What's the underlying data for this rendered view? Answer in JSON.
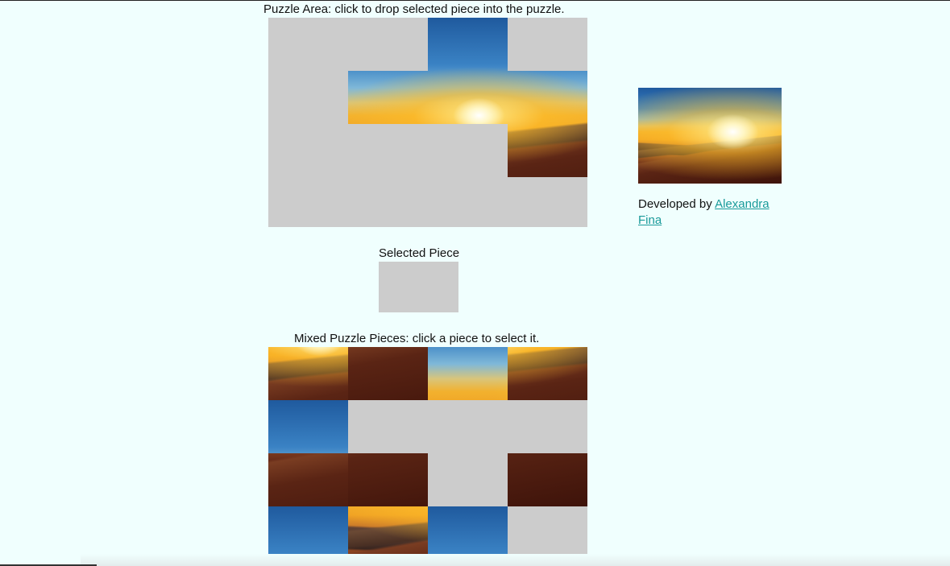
{
  "puzzle_area": {
    "label": "Puzzle Area: click to drop selected piece into the puzzle.",
    "rows": 4,
    "cols": 4,
    "placed": [
      {
        "row": 0,
        "col": 2,
        "piece": "r0c2"
      },
      {
        "row": 1,
        "col": 1,
        "piece": "r1c1"
      },
      {
        "row": 1,
        "col": 2,
        "piece": "r1c2"
      },
      {
        "row": 1,
        "col": 3,
        "piece": "r1c3"
      },
      {
        "row": 2,
        "col": 3,
        "piece": "r2c3"
      }
    ]
  },
  "selected": {
    "label": "Selected Piece"
  },
  "mixed_pieces": {
    "label": "Mixed Puzzle Pieces: click a piece to select it.",
    "slots": [
      "r2c2",
      "r3c1",
      "r1c0",
      "r2c3",
      "r0c0",
      null,
      null,
      null,
      "r3c0",
      "r3c2",
      null,
      "r3c3",
      "r0c1",
      "r2c1",
      "r0c3",
      null
    ]
  },
  "preview": {
    "alt": "sunset-photo"
  },
  "credit": {
    "prefix": "Developed by ",
    "author": "Alexandra Fina"
  }
}
